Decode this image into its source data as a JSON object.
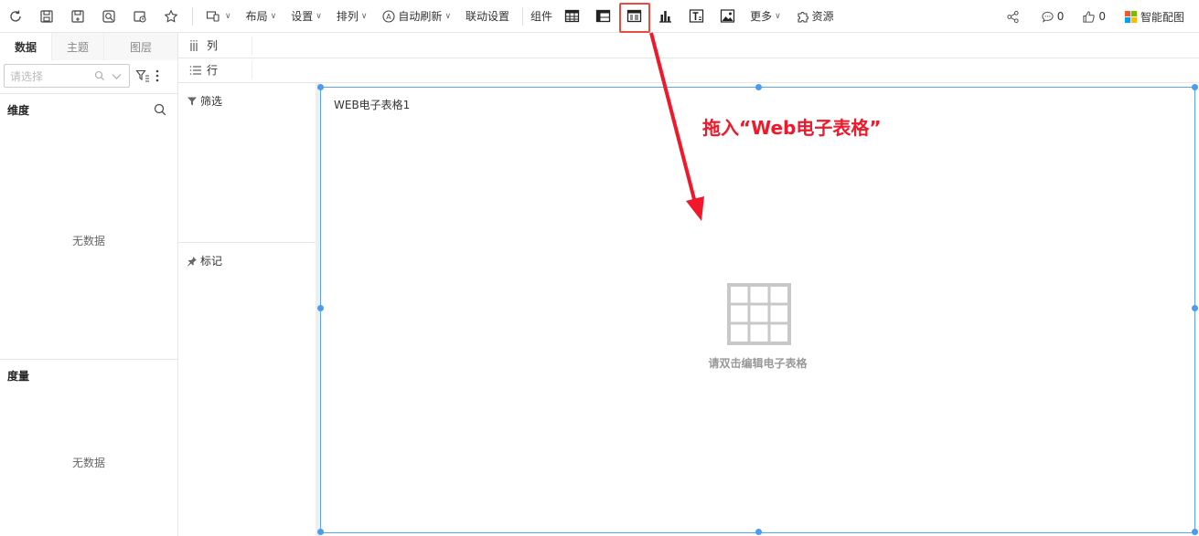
{
  "toolbar": {
    "icons": [
      "refresh-icon",
      "save-icon",
      "save-as-icon",
      "preview-icon",
      "schedule-icon",
      "favorite-icon"
    ],
    "device_caret": "∨",
    "layout_label": "布局",
    "settings_label": "设置",
    "arrange_label": "排列",
    "auto_refresh_label": "自动刷新",
    "linkage_label": "联动设置",
    "components_label": "组件",
    "more_label": "更多",
    "resources_label": "资源",
    "comments_count": "0",
    "likes_count": "0",
    "smart_color_label": "智能配图",
    "highlight_color": "#e74c3c"
  },
  "left_panel": {
    "tabs": [
      "数据",
      "主题",
      "图层"
    ],
    "search_placeholder": "请选择",
    "dimension_label": "维度",
    "dimension_empty": "无数据",
    "measure_label": "度量",
    "measure_empty": "无数据"
  },
  "shelves": {
    "columns_label": "列",
    "rows_label": "行"
  },
  "middle": {
    "filter_label": "筛选",
    "marks_label": "标记"
  },
  "canvas": {
    "component_title": "WEB电子表格1",
    "hint": "请双击编辑电子表格",
    "border_color": "#5ba4ef"
  },
  "annotation": {
    "text": "拖入“Web电子表格”",
    "color": "#f0182a"
  }
}
